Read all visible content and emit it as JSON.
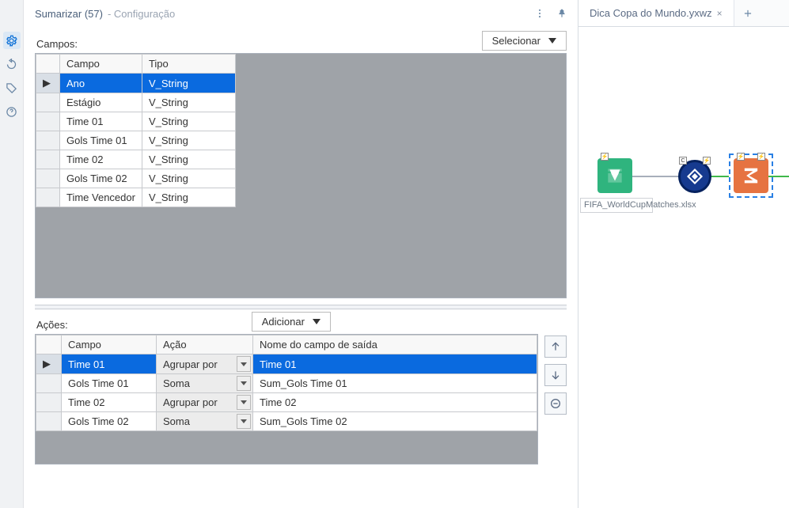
{
  "header": {
    "title": "Sumarizar (57)",
    "subtitle": "- Configuração"
  },
  "tabs": {
    "workflow_tab": "Dica Copa do Mundo.yxwz"
  },
  "campos": {
    "label": "Campos:",
    "select_button": "Selecionar",
    "columns": {
      "campo": "Campo",
      "tipo": "Tipo"
    },
    "rows": [
      {
        "campo": "Ano",
        "tipo": "V_String",
        "selected": true
      },
      {
        "campo": "Estágio",
        "tipo": "V_String",
        "selected": false
      },
      {
        "campo": "Time 01",
        "tipo": "V_String",
        "selected": false
      },
      {
        "campo": "Gols Time 01",
        "tipo": "V_String",
        "selected": false
      },
      {
        "campo": "Time 02",
        "tipo": "V_String",
        "selected": false
      },
      {
        "campo": "Gols Time 02",
        "tipo": "V_String",
        "selected": false
      },
      {
        "campo": "Time Vencedor",
        "tipo": "V_String",
        "selected": false
      }
    ]
  },
  "acoes": {
    "label": "Ações:",
    "add_button": "Adicionar",
    "columns": {
      "campo": "Campo",
      "acao": "Ação",
      "saida": "Nome do campo de saída"
    },
    "rows": [
      {
        "campo": "Time 01",
        "acao": "Agrupar por",
        "saida": "Time 01",
        "selected": true
      },
      {
        "campo": "Gols Time 01",
        "acao": "Soma",
        "saida": "Sum_Gols Time 01",
        "selected": false
      },
      {
        "campo": "Time 02",
        "acao": "Agrupar por",
        "saida": "Time 02",
        "selected": false
      },
      {
        "campo": "Gols Time 02",
        "acao": "Soma",
        "saida": "Sum_Gols Time 02",
        "selected": false
      }
    ]
  },
  "canvas": {
    "input_label": "FIFA_WorldCupMatches.xlsx"
  }
}
